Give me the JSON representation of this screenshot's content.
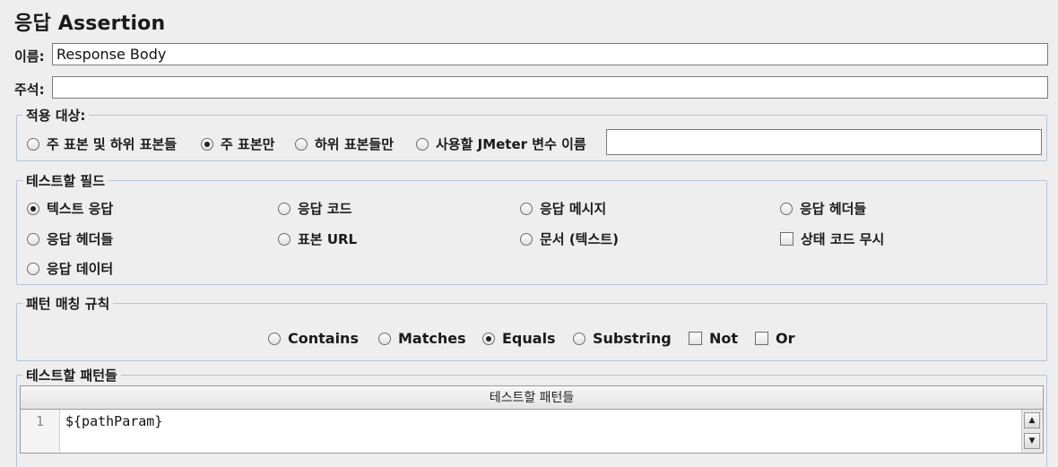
{
  "title": "응답 Assertion",
  "name_field": {
    "label": "이름:",
    "value": "Response Body"
  },
  "comment_field": {
    "label": "주석:",
    "value": ""
  },
  "apply_to": {
    "legend": "적용 대상:",
    "options": [
      {
        "label": "주 표본 및 하위 표본들",
        "selected": false
      },
      {
        "label": "주 표본만",
        "selected": true
      },
      {
        "label": "하위 표본들만",
        "selected": false
      },
      {
        "label": "사용할 JMeter 변수 이름",
        "selected": false
      }
    ],
    "variable_value": ""
  },
  "field_to_test": {
    "legend": "테스트할 필드",
    "options": [
      {
        "label": "텍스트 응답",
        "type": "radio",
        "selected": true
      },
      {
        "label": "응답 코드",
        "type": "radio",
        "selected": false
      },
      {
        "label": "응답 메시지",
        "type": "radio",
        "selected": false
      },
      {
        "label": "응답 헤더들",
        "type": "radio",
        "selected": false
      },
      {
        "label": "응답 헤더들",
        "type": "radio",
        "selected": false
      },
      {
        "label": "표본 URL",
        "type": "radio",
        "selected": false
      },
      {
        "label": "문서 (텍스트)",
        "type": "radio",
        "selected": false
      },
      {
        "label": "상태 코드 무시",
        "type": "checkbox",
        "checked": false
      },
      {
        "label": "응답 데이터",
        "type": "radio",
        "selected": false
      }
    ]
  },
  "pattern_matching": {
    "legend": "패턴 매칭 규칙",
    "options": [
      {
        "label": "Contains",
        "type": "radio",
        "selected": false
      },
      {
        "label": "Matches",
        "type": "radio",
        "selected": false
      },
      {
        "label": "Equals",
        "type": "radio",
        "selected": true
      },
      {
        "label": "Substring",
        "type": "radio",
        "selected": false
      },
      {
        "label": "Not",
        "type": "checkbox",
        "checked": false
      },
      {
        "label": "Or",
        "type": "checkbox",
        "checked": false
      }
    ]
  },
  "patterns": {
    "legend": "테스트할 패턴들",
    "column_header": "테스트할 패턴들",
    "rows": [
      {
        "line": "1",
        "text": "${pathParam}"
      }
    ]
  }
}
